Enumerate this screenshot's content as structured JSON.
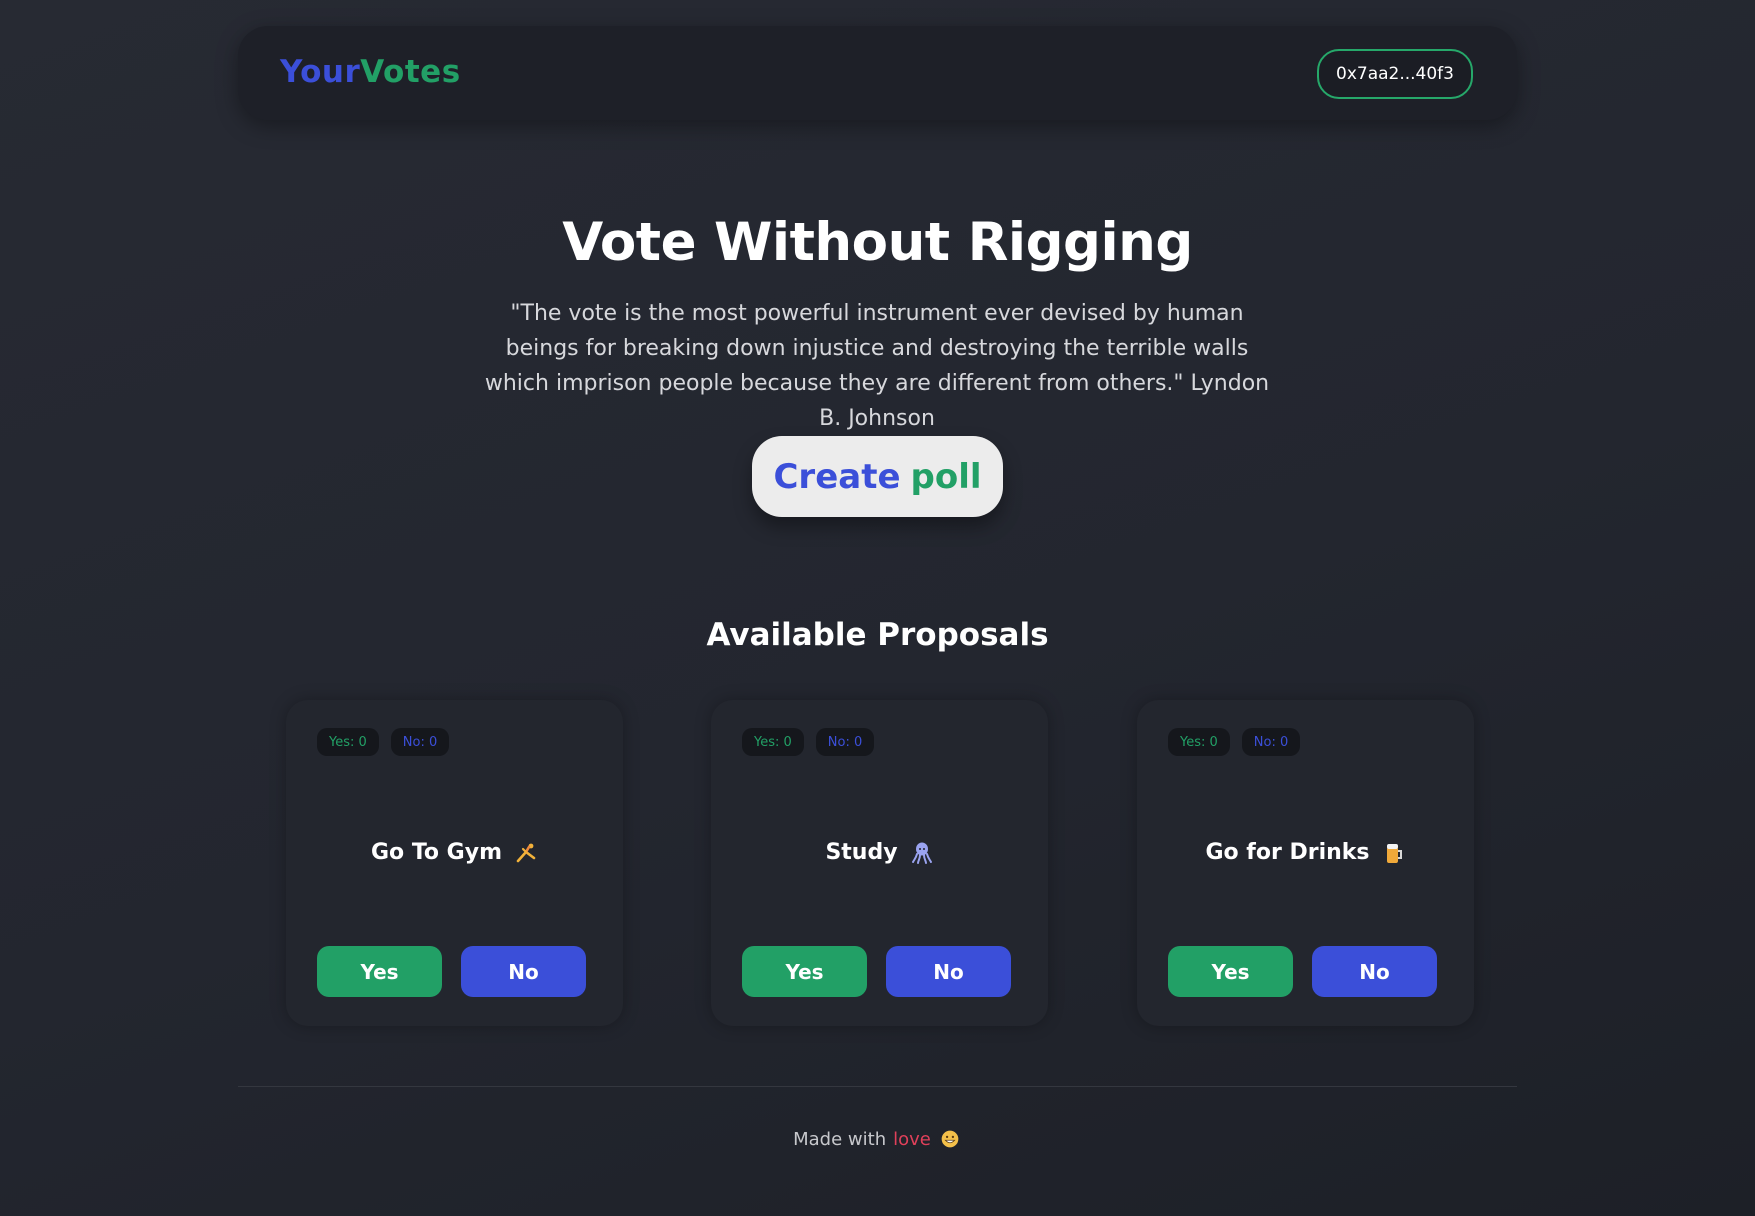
{
  "header": {
    "logo_part1": "Your",
    "logo_part2": "Votes",
    "wallet_address": "0x7aa2...40f3"
  },
  "hero": {
    "title": "Vote Without Rigging",
    "quote": "\"The vote is the most powerful instrument ever devised by human beings for breaking down injustice and destroying the terrible walls which imprison people because they are different from others.\" Lyndon B. Johnson",
    "create_word1": "Create",
    "create_word2": "poll"
  },
  "proposals": {
    "section_title": "Available Proposals",
    "items": [
      {
        "title": "Go To Gym",
        "icon": "person-doing-cartwheel-icon",
        "yes_count": "Yes: 0",
        "no_count": "No: 0",
        "yes_label": "Yes",
        "no_label": "No"
      },
      {
        "title": "Study",
        "icon": "octopus-icon",
        "yes_count": "Yes: 0",
        "no_count": "No: 0",
        "yes_label": "Yes",
        "no_label": "No"
      },
      {
        "title": "Go for Drinks",
        "icon": "beer-mug-icon",
        "yes_count": "Yes: 0",
        "no_count": "No: 0",
        "yes_label": "Yes",
        "no_label": "No"
      }
    ]
  },
  "footer": {
    "made_with": "Made with",
    "love": "love",
    "icon": "grinning-face-icon"
  },
  "colors": {
    "brand_blue": "#3b4fd9",
    "brand_green": "#22a066",
    "love_red": "#e0405a",
    "background": "#23262f"
  }
}
